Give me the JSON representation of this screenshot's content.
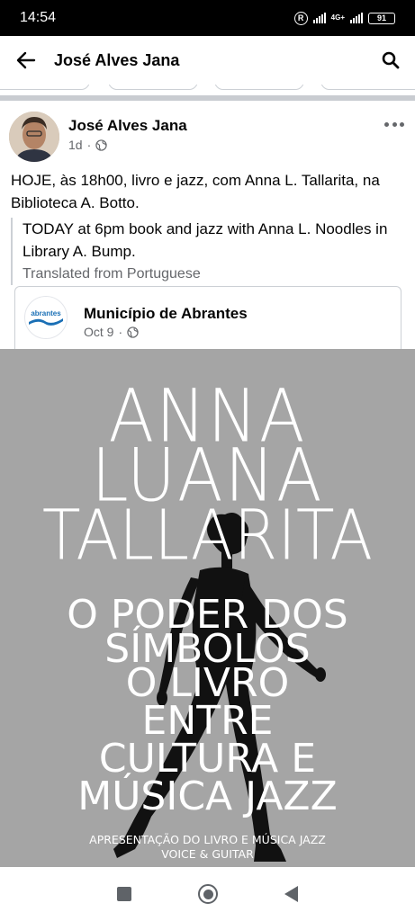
{
  "status_bar": {
    "time": "14:54",
    "network": "4G+",
    "battery": "91",
    "icons": [
      "registered-icon",
      "signal-icon",
      "battery-icon"
    ]
  },
  "header": {
    "title": "José Alves Jana",
    "back_icon": "arrow-left-icon",
    "search_icon": "search-icon"
  },
  "post": {
    "author": "José Alves Jana",
    "time": "1d",
    "audience_icon": "globe-icon",
    "text": "HOJE, às 18h00, livro e jazz, com Anna L. Tallarita, na Biblioteca A. Botto.",
    "translation": "TODAY at 6pm book and jazz with Anna L. Noodles in Library A. Bump.",
    "translated_from": "Translated from Portuguese",
    "shared": {
      "page_name": "Município de Abrantes",
      "logo_text": "abrantes",
      "date": "Oct 9"
    },
    "poster": {
      "name_lines": [
        "ANNA",
        "LUANA",
        "TALLARITA"
      ],
      "subtitle_lines": [
        "O PODER DOS",
        "SÍMBOLOS",
        "O LIVRO",
        "ENTRE",
        "CULTURA E",
        "MÚSICA JAZZ"
      ],
      "footer_lines": [
        "APRESENTAÇÃO DO LIVRO E MÚSICA JAZZ",
        "VOICE & GUITAR"
      ],
      "background": "#a5a5a5",
      "text_color": "#ffffff"
    }
  },
  "nav_bar": {
    "icons": [
      "recent-apps-icon",
      "home-icon",
      "back-icon"
    ]
  },
  "colors": {
    "secondary_text": "#65676b",
    "divider": "#c9ccd1",
    "logo_blue": "#1a6fb5"
  }
}
